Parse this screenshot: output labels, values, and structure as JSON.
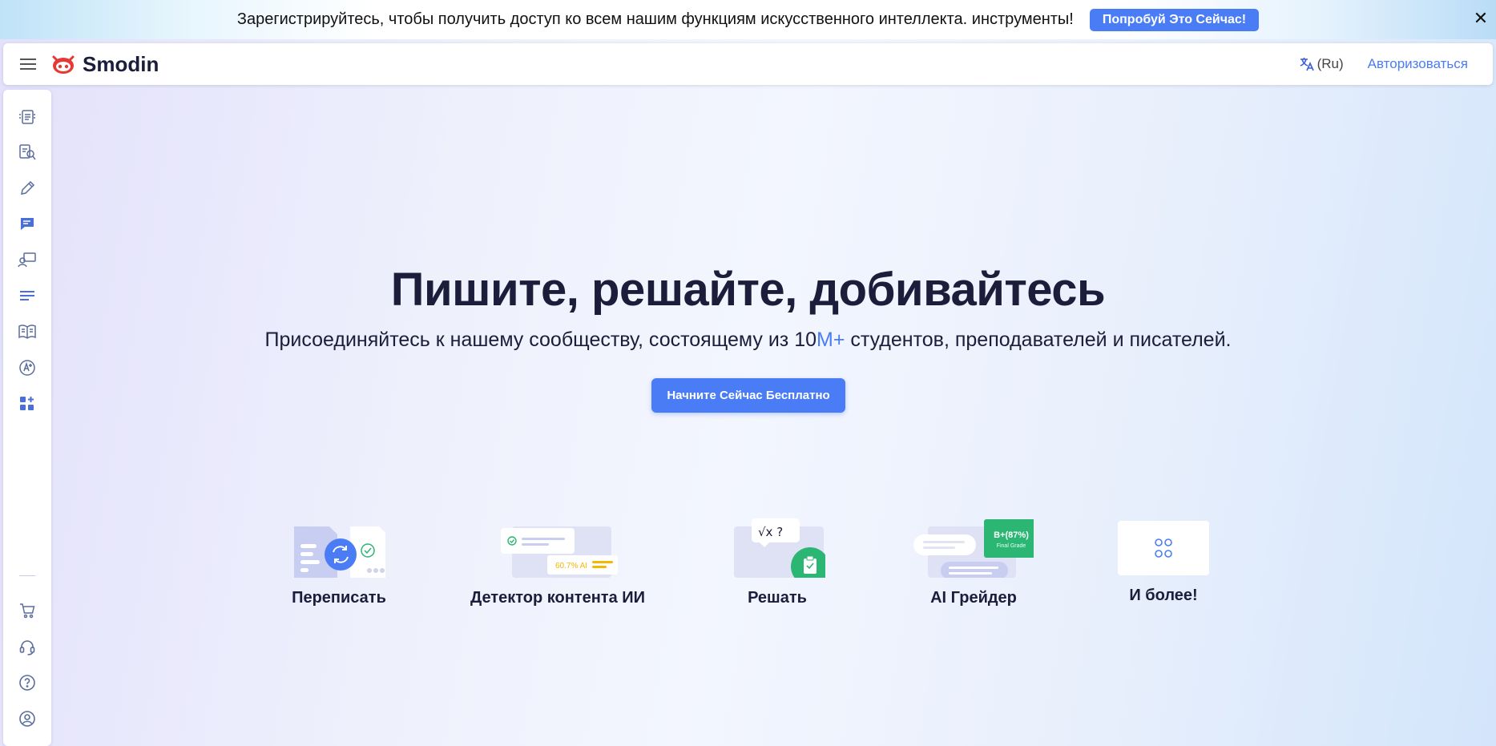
{
  "promo": {
    "text": "Зарегистрируйтесь, чтобы получить доступ ко всем нашим функциям искусственного интеллекта. инструменты!",
    "button_label": "Попробуй Это Сейчас!",
    "close_glyph": "✕"
  },
  "header": {
    "logo_text": "Smodin",
    "language_label": "(Ru)",
    "login_label": "Авторизоваться"
  },
  "sidebar": {
    "items": [
      {
        "icon": "rewrite-icon"
      },
      {
        "icon": "detector-icon"
      },
      {
        "icon": "pencil-icon"
      },
      {
        "icon": "chat-icon"
      },
      {
        "icon": "teacher-icon"
      },
      {
        "icon": "text-lines-icon"
      },
      {
        "icon": "book-icon"
      },
      {
        "icon": "grader-icon"
      },
      {
        "icon": "apps-icon"
      }
    ],
    "bottom_items": [
      {
        "icon": "cart-icon"
      },
      {
        "icon": "headset-icon"
      },
      {
        "icon": "help-icon"
      },
      {
        "icon": "account-icon"
      }
    ]
  },
  "hero": {
    "title": "Пишите, решайте, добивайтесь",
    "subtitle_before": "Присоединяйтесь к нашему сообществу, состоящему из 10",
    "subtitle_accent": "M+",
    "subtitle_after": " студентов, преподавателей и писателей.",
    "cta_label": "Начните Сейчас Бесплатно"
  },
  "features": {
    "rewrite": {
      "label": "Переписать"
    },
    "detector": {
      "label": "Детектор контента ИИ",
      "badge": "60.7% AI"
    },
    "solve": {
      "label": "Решать",
      "formula": "√x ?"
    },
    "grader": {
      "label": "AI Грейдер",
      "grade": "B+(87%)",
      "grade_caption": "Final Grade"
    },
    "more": {
      "label": "И более!"
    }
  },
  "colors": {
    "accent": "#4a7cf5",
    "text_dark": "#1b1d3a",
    "grade_green": "#2bb673"
  }
}
